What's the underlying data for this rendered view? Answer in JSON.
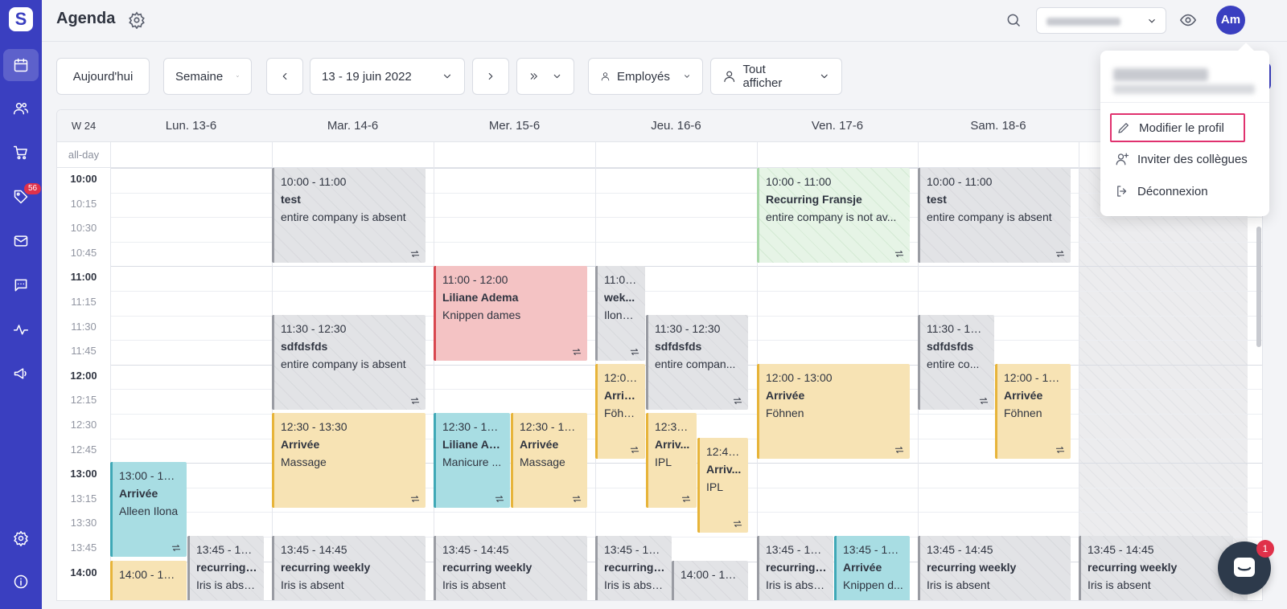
{
  "app": {
    "title": "Agenda",
    "logo": "S"
  },
  "topbar": {
    "user_name": "Amber Kortesje",
    "avatar_initials": "Am"
  },
  "sidebar": {
    "badge_count": "56"
  },
  "toolbar": {
    "today_label": "Aujourd'hui",
    "view_label": "Semaine",
    "date_range": "13 - 19 juin 2022",
    "employees_label": "Employés",
    "filter_label": "Tout afficher"
  },
  "calendar": {
    "week_label": "W 24",
    "allday_label": "all-day",
    "days": [
      "Lun. 13-6",
      "Mar. 14-6",
      "Mer. 15-6",
      "Jeu. 16-6",
      "Ven. 17-6",
      "Sam. 18-6"
    ],
    "times": [
      "10:00",
      "10:15",
      "10:30",
      "10:45",
      "11:00",
      "11:15",
      "11:30",
      "11:45",
      "12:00",
      "12:15",
      "12:30",
      "12:45",
      "13:00",
      "13:15",
      "13:30",
      "13:45",
      "14:00"
    ],
    "events": [
      {
        "time": "10:00 - 11:00",
        "name": "test",
        "desc": "entire company is absent"
      },
      {
        "time": "10:00 - 11:00",
        "name": "Recurring Fransje",
        "desc": "entire company is not av..."
      },
      {
        "time": "10:00 - 11:00",
        "name": "test",
        "desc": "entire company is absent"
      },
      {
        "time": "11:00 - 12:00",
        "name": "Liliane Adema",
        "desc": "Knippen dames"
      },
      {
        "time": "11:00 ...",
        "name": "wek...",
        "desc": "Ilona ..."
      },
      {
        "time": "11:30 - 12:30",
        "name": "sdfdsfds",
        "desc": "entire company is absent"
      },
      {
        "time": "11:30 - 12:30",
        "name": "sdfdsfds",
        "desc": "entire compan..."
      },
      {
        "time": "11:30 - 12:30",
        "name": "sdfdsfds",
        "desc": "entire co..."
      },
      {
        "time": "12:00...",
        "name": "Arriv...",
        "desc": "Föhnen"
      },
      {
        "time": "12:00 - 13:00",
        "name": "Arrivée",
        "desc": "Föhnen"
      },
      {
        "time": "12:00 - 13:00",
        "name": "Arrivée",
        "desc": "Föhnen"
      },
      {
        "time": "12:30 - 13:30",
        "name": "Arrivée",
        "desc": "Massage"
      },
      {
        "time": "12:30 - 13:30",
        "name": "Liliane Ad...",
        "desc": "Manicure ..."
      },
      {
        "time": "12:30 - 13:30",
        "name": "Arrivée",
        "desc": "Massage"
      },
      {
        "time": "12:30...",
        "name": "Arriv...",
        "desc": "IPL"
      },
      {
        "time": "12:45...",
        "name": "Arriv...",
        "desc": "IPL"
      },
      {
        "time": "13:00 - 14:00",
        "name": "Arrivée",
        "desc": "Alleen Ilona"
      },
      {
        "time": "13:45 - 14:45",
        "name": "recurring ...",
        "desc": "Iris is absent"
      },
      {
        "time": "13:45 - 14:45",
        "name": "recurring weekly",
        "desc": "Iris is absent"
      },
      {
        "time": "13:45 - 14:45",
        "name": "recurring weekly",
        "desc": "Iris is absent"
      },
      {
        "time": "13:45 - 14:45",
        "name": "recurring ...",
        "desc": "Iris is absent"
      },
      {
        "time": "13:45 - 14:45",
        "name": "recurring ...",
        "desc": "Iris is absent"
      },
      {
        "time": "13:45 - 14:45",
        "name": "Arrivée",
        "desc": "Knippen d..."
      },
      {
        "time": "13:45 - 14:45",
        "name": "recurring weekly",
        "desc": "Iris is absent"
      },
      {
        "time": "13:45 - 14:45",
        "name": "recurring weekly",
        "desc": "Iris is absent"
      },
      {
        "time": "14:00 - 15:00",
        "name": "",
        "desc": ""
      },
      {
        "time": "14:00 - 15:00",
        "name": "",
        "desc": ""
      }
    ]
  },
  "profile_menu": {
    "user_name": "Amber Kortesje",
    "user_email": "amber@example.com",
    "items": [
      "Modifier le profil",
      "Inviter des collègues",
      "Déconnexion"
    ]
  },
  "chat": {
    "badge": "1"
  },
  "colors": {
    "sidebar": "#3a3fc0",
    "highlight": "#e0316e",
    "gray_event": "#e2e3e6",
    "pink_event": "#f4c3c4",
    "yellow_event": "#f7e3b4",
    "blue_event": "#a8dde3",
    "green_event": "#e6f4e6"
  }
}
